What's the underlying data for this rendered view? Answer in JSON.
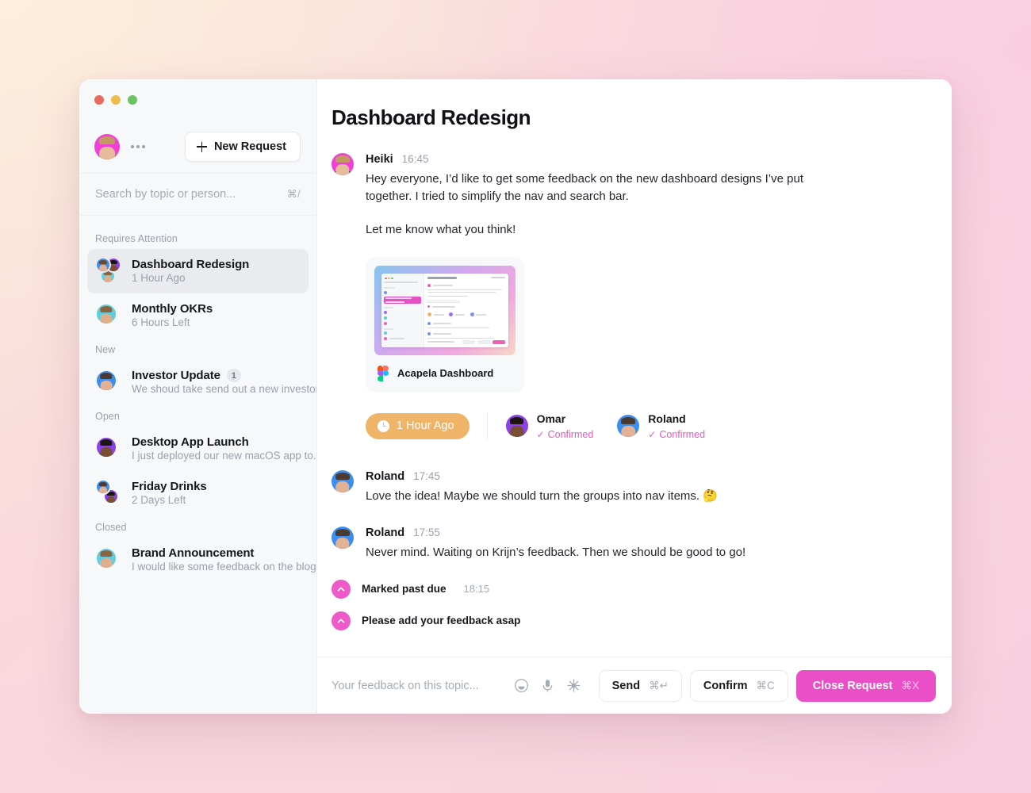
{
  "window": {
    "traffic_lights": [
      "close",
      "minimize",
      "zoom"
    ]
  },
  "sidebar": {
    "profile": {
      "menu_icon": "ellipsis-icon"
    },
    "new_request_label": "New Request",
    "search": {
      "placeholder": "Search by topic or person...",
      "value": "",
      "shortcut": "⌘/"
    },
    "groups": [
      {
        "label": "Requires Attention",
        "items": [
          {
            "title": "Dashboard Redesign",
            "subtitle": "1 Hour Ago",
            "active": true,
            "badge": ""
          },
          {
            "title": "Monthly OKRs",
            "subtitle": "6 Hours Left",
            "active": false,
            "badge": ""
          }
        ]
      },
      {
        "label": "New",
        "items": [
          {
            "title": "Investor Update",
            "subtitle": "We shoud take send out a new investor...",
            "active": false,
            "badge": "1"
          }
        ]
      },
      {
        "label": "Open",
        "items": [
          {
            "title": "Desktop App Launch",
            "subtitle": "I just deployed our new macOS app to...",
            "active": false,
            "badge": ""
          },
          {
            "title": "Friday Drinks",
            "subtitle": "2 Days Left",
            "active": false,
            "badge": ""
          }
        ]
      },
      {
        "label": "Closed",
        "items": [
          {
            "title": "Brand Announcement",
            "subtitle": "I would like some feedback on the blog...",
            "active": false,
            "badge": ""
          }
        ]
      }
    ]
  },
  "main": {
    "title": "Dashboard Redesign",
    "messages": [
      {
        "author": "Heiki",
        "time": "16:45",
        "paragraphs": [
          "Hey everyone, I’d like to get some feedback on the new dashboard designs I’ve put together. I tried to simplify the nav and search bar.",
          "Let me know what you think!"
        ]
      },
      {
        "author": "Roland",
        "time": "17:45",
        "paragraphs": [
          "Love the idea! Maybe we should turn the groups into nav items. 🤔"
        ]
      },
      {
        "author": "Roland",
        "time": "17:55",
        "paragraphs": [
          "Never mind. Waiting on Krijn’s feedback. Then we should be good to go!"
        ]
      }
    ],
    "attachment": {
      "name": "Acapela Dashboard",
      "source_icon": "figma-icon"
    },
    "status": {
      "due_label": "1 Hour Ago",
      "due_icon": "clock-icon",
      "confirmations": [
        {
          "name": "Omar",
          "status": "Confirmed"
        },
        {
          "name": "Roland",
          "status": "Confirmed"
        }
      ]
    },
    "notices": [
      {
        "text": "Marked past due",
        "time": "18:15",
        "icon": "chevron-up-icon"
      },
      {
        "text": "Please add your feedback asap",
        "time": "",
        "icon": "chevron-up-icon"
      }
    ]
  },
  "composer": {
    "placeholder": "Your feedback on this topic...",
    "value": "",
    "icons": [
      "emoji-icon",
      "microphone-icon",
      "sparkle-icon"
    ],
    "buttons": [
      {
        "label": "Send",
        "shortcut": "⌘↵",
        "primary": false
      },
      {
        "label": "Confirm",
        "shortcut": "⌘C",
        "primary": false
      },
      {
        "label": "Close Request",
        "shortcut": "⌘X",
        "primary": true
      }
    ]
  },
  "colors": {
    "accent": "#ea4fc8",
    "due": "#f0b468",
    "confirmed": "#e757c6",
    "sidebar_bg": "#f7f8fa"
  }
}
